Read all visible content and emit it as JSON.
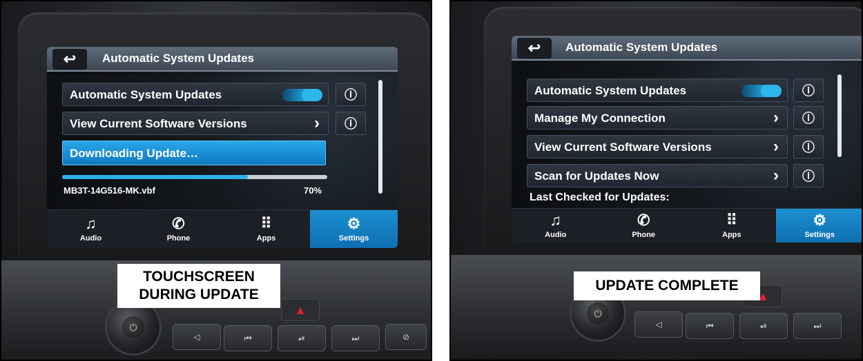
{
  "left_panel": {
    "screen": {
      "title": "Automatic System Updates",
      "back_icon": "↩",
      "rows": [
        {
          "label": "Automatic System Updates",
          "toggle_on": true
        },
        {
          "label": "View Current Software Versions",
          "chevron": "›"
        }
      ],
      "download_label": "Downloading Update…",
      "file_name": "MB3T-14G516-MK.vbf",
      "progress_text": "70%",
      "progress_value": 0.7,
      "info_icon": "ⓘ"
    },
    "nav": [
      {
        "label": "Audio",
        "icon": "♫"
      },
      {
        "label": "Phone",
        "icon": "✆"
      },
      {
        "label": "Apps",
        "icon": "⠿"
      },
      {
        "label": "Settings",
        "icon": "⚙"
      }
    ],
    "caption_line1": "TOUCHSCREEN",
    "caption_line2": "DURING UPDATE"
  },
  "right_panel": {
    "screen": {
      "title": "Automatic System Updates",
      "back_icon": "↩",
      "rows": [
        {
          "label": "Automatic System Updates",
          "toggle_on": true
        },
        {
          "label": "Manage My Connection",
          "chevron": "›"
        },
        {
          "label": "View Current Software Versions",
          "chevron": "›"
        },
        {
          "label": "Scan for Updates Now",
          "chevron": "›"
        }
      ],
      "last_checked": "Last Checked for Updates:",
      "info_icon": "ⓘ"
    },
    "nav": [
      {
        "label": "Audio",
        "icon": "♫"
      },
      {
        "label": "Phone",
        "icon": "✆"
      },
      {
        "label": "Apps",
        "icon": "⠿"
      },
      {
        "label": "Settings",
        "icon": "⚙"
      }
    ],
    "caption": "UPDATE COMPLETE"
  },
  "hardware": {
    "power_icon": "⏻",
    "hazard_icon": "▲",
    "buttons": [
      "◁",
      "⏮",
      "⏯",
      "⏭",
      "⊘"
    ]
  },
  "colors": {
    "accent": "#1e9be0",
    "active_nav": "#1482c8"
  }
}
